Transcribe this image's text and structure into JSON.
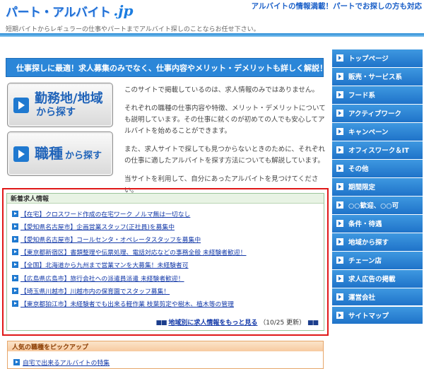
{
  "header": {
    "logo_text": "パート・アルバイト",
    "logo_suffix": ".jp",
    "tagline_right": "アルバイトの情報満載！パートでお探しの方も対応",
    "subtitle": "短期バイトからレギュラーの仕事やパートまでアルバイト探しのことならお任せ下さい。"
  },
  "banner": "仕事探しに最適！求人募集のみでなく、仕事内容やメリット・デメリットも詳しく解説！",
  "buttons": {
    "area_line1": "勤務地/地域",
    "area_line2": "から探す",
    "type_line1": "職種",
    "type_line2": "から探す"
  },
  "intro": [
    "このサイトで掲載しているのは、求人情報のみではありません。",
    "それぞれの職種の仕事内容や特徴、メリット・デメリットについても説明しています。その仕事に就くのが初めての人でも安心してアルバイトを始めることができます。",
    "また、求人サイトで探しても見つからないときのために、それぞれの仕事に適したアルバイトを探す方法についても解説しています。",
    "当サイトを利用して、自分にあったアルバイトを見つけてください。"
  ],
  "new_listings": {
    "title": "新着求人情報",
    "items": [
      "【在宅】クロスワード作成の在宅ワーク ノルマ無は一切なし",
      "【愛知県名古屋市】企画営業スタッフ(正社員)を募集中",
      "【愛知県名古屋市】コールセンタ・オペレータスタッフを募集中",
      "【東京都新宿区】書類整理や伝票処理、電話対応などの事務全般 未経験者歓迎！",
      "【全国】北海道から九州まで営業マンを大募集！未経験者可",
      "【広島県広島市】旅行会社への派遣員派遣 未経験者歓迎！",
      "【埼玉県川越市】川越市内の保育園でスタッフ募集！",
      "【東京都狛江市】未経験者でも出来る軽作業 枝葉剪定や樹木、植木等の管理"
    ],
    "more_prefix": "■■",
    "more_link": "地域別に求人情報をもっと見る",
    "more_date": "（10/25 更新）",
    "more_suffix": "■■"
  },
  "popular": {
    "title": "人気の職種をピックアップ",
    "item": "自宅で出来るアルバイトの特集"
  },
  "sidenav": [
    "トップページ",
    "販売・サービス系",
    "フード系",
    "アクティブワーク",
    "キャンペーン",
    "オフィスワーク＆IT",
    "その他",
    "期間限定",
    "○○歓迎、○○可",
    "条件・待遇",
    "地域から探す",
    "チェーン店",
    "求人広告の掲載",
    "運営会社",
    "サイトマップ"
  ]
}
